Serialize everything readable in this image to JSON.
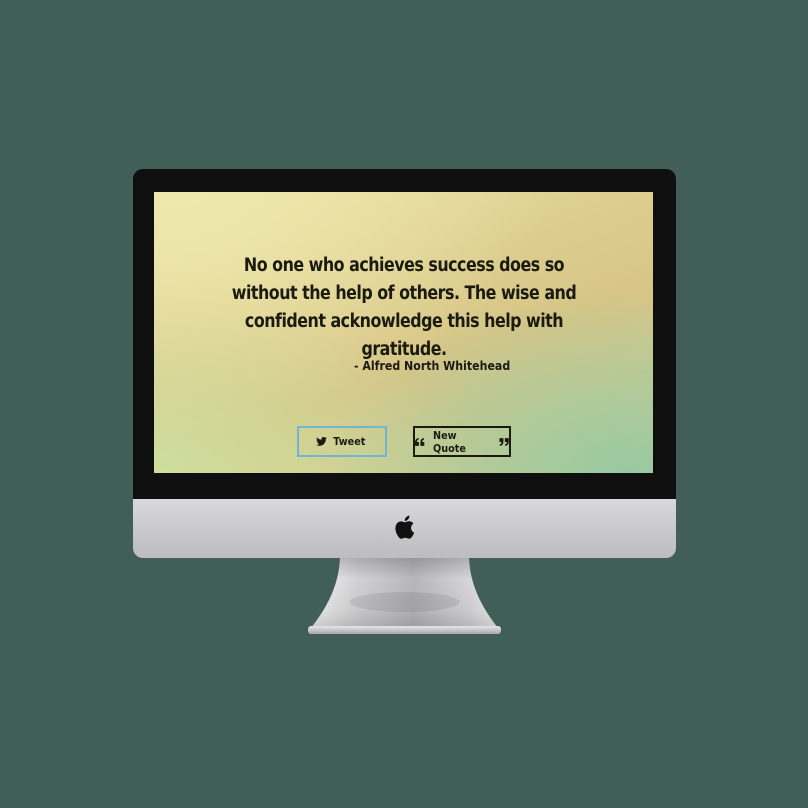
{
  "quote": {
    "text": "No one who achieves success does so without the help of others. The wise and confident acknowledge this help with gratitude.",
    "author": "- Alfred North Whitehead"
  },
  "buttons": {
    "tweet_label": "Tweet",
    "tweet_icon": "twitter-bird-icon",
    "new_quote_label": "New Quote",
    "new_quote_icons": [
      "quote-left-icon",
      "quote-right-icon"
    ]
  },
  "device": {
    "logo": "apple-logo-icon"
  },
  "colors": {
    "page_background": "#415f56",
    "bezel": "#0f0f0f",
    "tweet_border": "#72b4d6",
    "text": "#1a1a10"
  }
}
